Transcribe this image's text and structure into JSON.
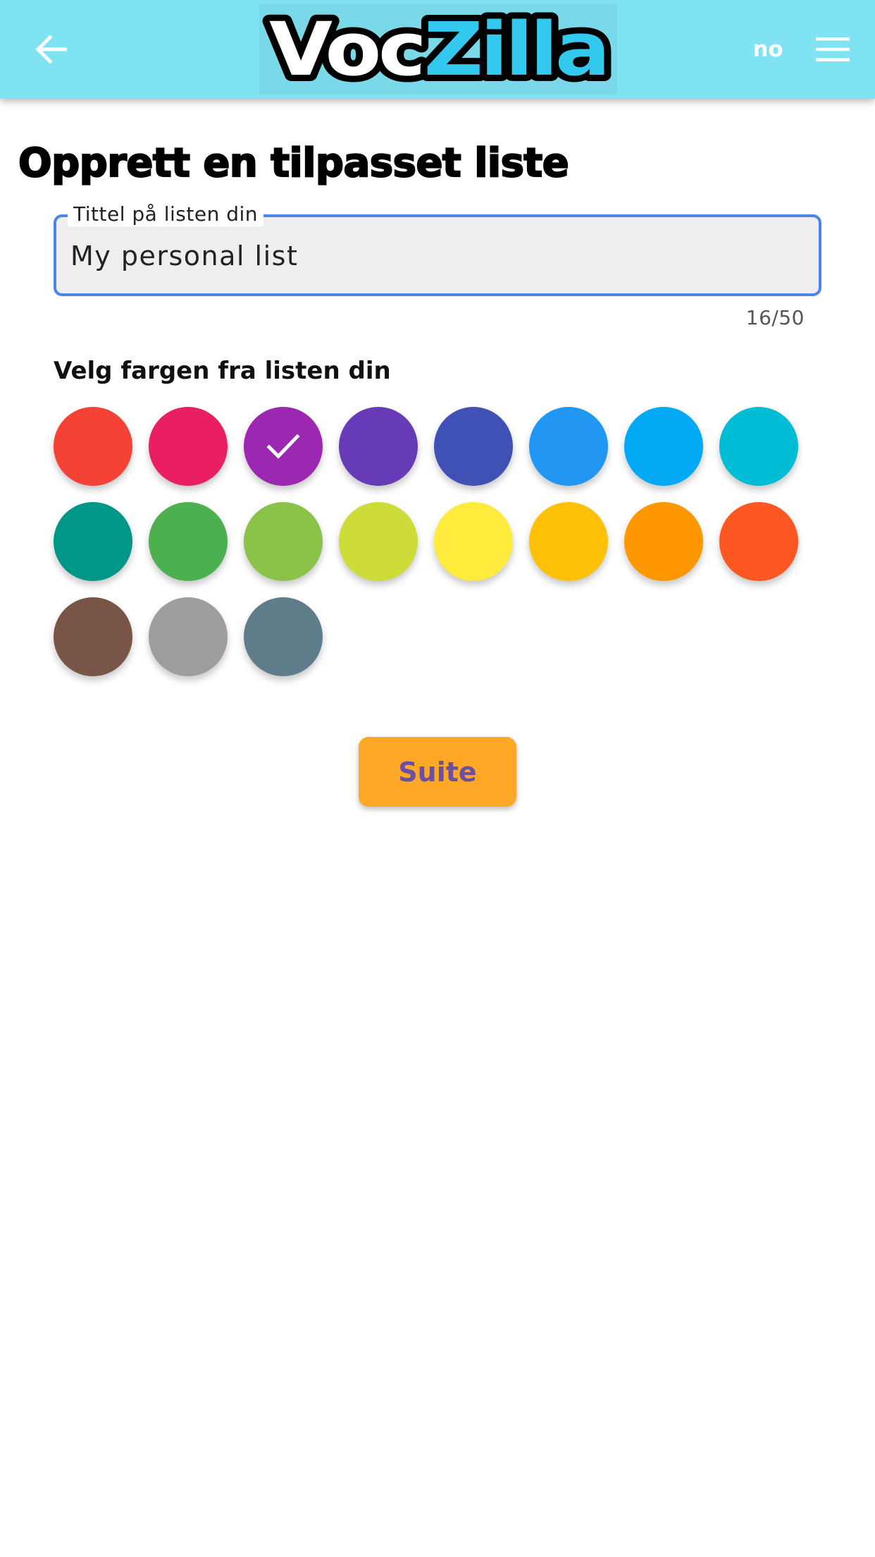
{
  "app_bar": {
    "logo": {
      "part1": "Voc",
      "part2": "Zilla",
      "part1_color": "#ffffff",
      "part2_color": "#33c8ee",
      "outline_color": "#000000"
    },
    "back_icon": "arrow-back-icon",
    "language_label": "no",
    "menu_icon": "hamburger-menu-icon",
    "background_color": "#7fe3f1"
  },
  "page": {
    "title": "Opprett en tilpasset liste"
  },
  "title_field": {
    "label": "Tittel på listen din",
    "value": "My personal list",
    "counter": "16/50",
    "border_color": "#4a86e8"
  },
  "colors_section": {
    "heading": "Velg fargen fra listen din",
    "selected_index": 2,
    "check_icon": "check-icon",
    "swatches": [
      {
        "color": "#f44336"
      },
      {
        "color": "#e91e63"
      },
      {
        "color": "#9c27b0"
      },
      {
        "color": "#673ab7"
      },
      {
        "color": "#3f51b5"
      },
      {
        "color": "#2196f3"
      },
      {
        "color": "#03a9f4"
      },
      {
        "color": "#00bcd4"
      },
      {
        "color": "#009688"
      },
      {
        "color": "#4caf50"
      },
      {
        "color": "#8bc34a"
      },
      {
        "color": "#cddc39"
      },
      {
        "color": "#ffeb3b"
      },
      {
        "color": "#ffc107"
      },
      {
        "color": "#ff9800"
      },
      {
        "color": "#ff5722"
      },
      {
        "color": "#795548"
      },
      {
        "color": "#9e9e9e"
      },
      {
        "color": "#607d8b"
      }
    ]
  },
  "actions": {
    "next_label": "Suite",
    "next_color": "#ffa726",
    "next_text_color": "#6b4fa3"
  }
}
